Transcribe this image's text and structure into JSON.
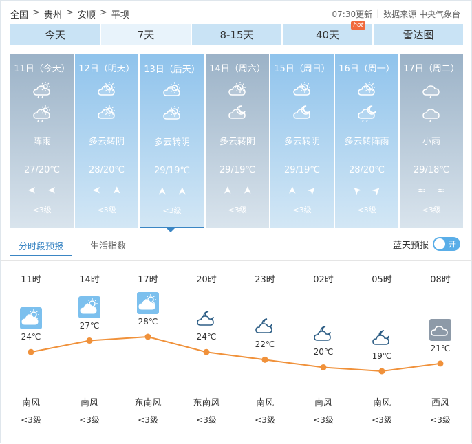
{
  "breadcrumb": [
    "全国",
    "贵州",
    "安顺",
    "平坝"
  ],
  "breadcrumb_sep": ">",
  "update": {
    "time": "07:30更新",
    "source": "数据来源 中央气象台"
  },
  "tabs": [
    {
      "label": "今天"
    },
    {
      "label": "7天",
      "active": true
    },
    {
      "label": "8-15天"
    },
    {
      "label": "40天",
      "badge": "hot"
    },
    {
      "label": "雷达图"
    }
  ],
  "days": [
    {
      "title": "11日（今天）",
      "icon1": "shower-icon",
      "icon2": "shower-icon",
      "desc": "阵雨",
      "temp": "27/20℃",
      "wind": [
        "➤",
        "➤"
      ],
      "level": "<3级",
      "dim": true
    },
    {
      "title": "12日（明天）",
      "icon1": "partly-cloudy-icon",
      "icon2": "partly-cloudy-icon",
      "desc": "多云转阴",
      "temp": "28/20℃",
      "wind": [
        "➤",
        "➤"
      ],
      "level": "<3级"
    },
    {
      "title": "13日（后天）",
      "icon1": "partly-cloudy-icon",
      "icon2": "partly-cloudy-icon",
      "desc": "多云转阴",
      "temp": "29/19℃",
      "wind": [
        "➤",
        "➤"
      ],
      "level": "<3级",
      "selected": true
    },
    {
      "title": "14日（周六）",
      "icon1": "partly-cloudy-icon",
      "icon2": "partly-cloudy-night-icon",
      "desc": "多云转阴",
      "temp": "29/19℃",
      "wind": [
        "➤",
        "➤"
      ],
      "level": "<3级",
      "dim": true
    },
    {
      "title": "15日（周日）",
      "icon1": "partly-cloudy-icon",
      "icon2": "partly-cloudy-night-icon",
      "desc": "多云转阴",
      "temp": "29/19℃",
      "wind": [
        "➤",
        "➤"
      ],
      "level": "<3级"
    },
    {
      "title": "16日（周一）",
      "icon1": "partly-cloudy-icon",
      "icon2": "shower-night-icon",
      "desc": "多云转阵雨",
      "temp": "28/20℃",
      "wind": [
        "➤",
        "➤"
      ],
      "level": "<3级"
    },
    {
      "title": "17日（周二）",
      "icon1": "light-rain-icon",
      "icon2": "light-rain-icon",
      "desc": "小雨",
      "temp": "29/18℃",
      "wind": [
        "≈",
        "≈"
      ],
      "level": "<3级",
      "dim": true
    }
  ],
  "subtabs": [
    {
      "label": "分时段预报",
      "active": true
    },
    {
      "label": "生活指数"
    }
  ],
  "blue_sky": {
    "label": "蓝天预报",
    "toggle": "开"
  },
  "hourly": [
    {
      "time": "11时",
      "icon": "partly-cloudy-day-icon",
      "temp": 24,
      "temp_label": "24℃",
      "wind": "南风",
      "level": "<3级"
    },
    {
      "time": "14时",
      "icon": "partly-cloudy-day-icon",
      "temp": 27,
      "temp_label": "27℃",
      "wind": "南风",
      "level": "<3级"
    },
    {
      "time": "17时",
      "icon": "partly-cloudy-day-icon",
      "temp": 28,
      "temp_label": "28℃",
      "wind": "东南风",
      "level": "<3级"
    },
    {
      "time": "20时",
      "icon": "partly-cloudy-night-icon",
      "temp": 24,
      "temp_label": "24℃",
      "wind": "东南风",
      "level": "<3级"
    },
    {
      "time": "23时",
      "icon": "partly-cloudy-night-icon",
      "temp": 22,
      "temp_label": "22℃",
      "wind": "南风",
      "level": "<3级"
    },
    {
      "time": "02时",
      "icon": "partly-cloudy-night-icon",
      "temp": 20,
      "temp_label": "20℃",
      "wind": "南风",
      "level": "<3级"
    },
    {
      "time": "05时",
      "icon": "partly-cloudy-night-icon",
      "temp": 19,
      "temp_label": "19℃",
      "wind": "南风",
      "level": "<3级"
    },
    {
      "time": "08时",
      "icon": "cloudy-icon",
      "temp": 21,
      "temp_label": "21℃",
      "wind": "西风",
      "level": "<3级"
    }
  ],
  "colors": {
    "tab_bg": "#c9e3f5",
    "card_top": "#8fc3ec",
    "curve": "#f0913a",
    "accent": "#3b86c4"
  }
}
